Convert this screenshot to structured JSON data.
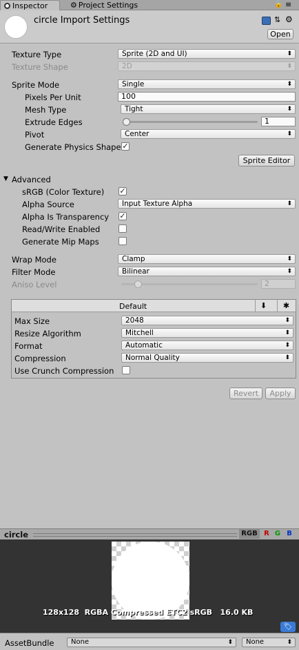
{
  "tabs": [
    {
      "label": "Inspector"
    },
    {
      "label": "Project Settings"
    }
  ],
  "header": {
    "title": "circle Import Settings",
    "open_label": "Open"
  },
  "texture_type": {
    "label": "Texture Type",
    "value": "Sprite (2D and UI)"
  },
  "texture_shape": {
    "label": "Texture Shape",
    "value": "2D"
  },
  "sprite_mode": {
    "label": "Sprite Mode",
    "value": "Single"
  },
  "pixels_per_unit": {
    "label": "Pixels Per Unit",
    "value": "100"
  },
  "mesh_type": {
    "label": "Mesh Type",
    "value": "Tight"
  },
  "extrude_edges": {
    "label": "Extrude Edges",
    "value": "1"
  },
  "pivot": {
    "label": "Pivot",
    "value": "Center"
  },
  "generate_physics_shape": {
    "label": "Generate Physics Shape",
    "checked": true
  },
  "sprite_editor_label": "Sprite Editor",
  "advanced": {
    "label": "Advanced",
    "srgb": {
      "label": "sRGB (Color Texture)",
      "checked": true
    },
    "alpha_source": {
      "label": "Alpha Source",
      "value": "Input Texture Alpha"
    },
    "alpha_is_transparency": {
      "label": "Alpha Is Transparency",
      "checked": true
    },
    "read_write": {
      "label": "Read/Write Enabled",
      "checked": false
    },
    "mip_maps": {
      "label": "Generate Mip Maps",
      "checked": false
    }
  },
  "wrap_mode": {
    "label": "Wrap Mode",
    "value": "Clamp"
  },
  "filter_mode": {
    "label": "Filter Mode",
    "value": "Bilinear"
  },
  "aniso_level": {
    "label": "Aniso Level",
    "value": "2"
  },
  "platform": {
    "tab_label": "Default",
    "max_size": {
      "label": "Max Size",
      "value": "2048"
    },
    "resize_algorithm": {
      "label": "Resize Algorithm",
      "value": "Mitchell"
    },
    "format": {
      "label": "Format",
      "value": "Automatic"
    },
    "compression": {
      "label": "Compression",
      "value": "Normal Quality"
    },
    "crunch": {
      "label": "Use Crunch Compression",
      "checked": false
    }
  },
  "revert_label": "Revert",
  "apply_label": "Apply",
  "preview": {
    "name": "circle",
    "channels": [
      "RGB",
      "R",
      "G",
      "B"
    ],
    "channel_colors": [
      "#000000",
      "#c40000",
      "#009a00",
      "#0033cc"
    ],
    "info": "128x128  RGBA Compressed ETC2 sRGB   16.0 KB"
  },
  "asset_bundle": {
    "label": "AssetBundle",
    "value": "None",
    "variant": "None"
  }
}
